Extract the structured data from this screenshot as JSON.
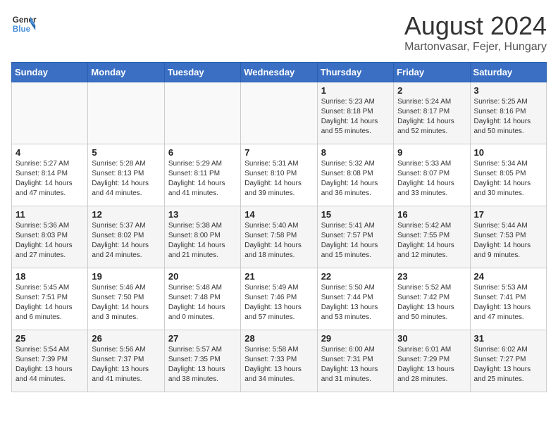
{
  "logo": {
    "line1": "General",
    "line2": "Blue"
  },
  "title": "August 2024",
  "subtitle": "Martonvasar, Fejer, Hungary",
  "days_of_week": [
    "Sunday",
    "Monday",
    "Tuesday",
    "Wednesday",
    "Thursday",
    "Friday",
    "Saturday"
  ],
  "weeks": [
    [
      {
        "day": "",
        "info": ""
      },
      {
        "day": "",
        "info": ""
      },
      {
        "day": "",
        "info": ""
      },
      {
        "day": "",
        "info": ""
      },
      {
        "day": "1",
        "info": "Sunrise: 5:23 AM\nSunset: 8:18 PM\nDaylight: 14 hours\nand 55 minutes."
      },
      {
        "day": "2",
        "info": "Sunrise: 5:24 AM\nSunset: 8:17 PM\nDaylight: 14 hours\nand 52 minutes."
      },
      {
        "day": "3",
        "info": "Sunrise: 5:25 AM\nSunset: 8:16 PM\nDaylight: 14 hours\nand 50 minutes."
      }
    ],
    [
      {
        "day": "4",
        "info": "Sunrise: 5:27 AM\nSunset: 8:14 PM\nDaylight: 14 hours\nand 47 minutes."
      },
      {
        "day": "5",
        "info": "Sunrise: 5:28 AM\nSunset: 8:13 PM\nDaylight: 14 hours\nand 44 minutes."
      },
      {
        "day": "6",
        "info": "Sunrise: 5:29 AM\nSunset: 8:11 PM\nDaylight: 14 hours\nand 41 minutes."
      },
      {
        "day": "7",
        "info": "Sunrise: 5:31 AM\nSunset: 8:10 PM\nDaylight: 14 hours\nand 39 minutes."
      },
      {
        "day": "8",
        "info": "Sunrise: 5:32 AM\nSunset: 8:08 PM\nDaylight: 14 hours\nand 36 minutes."
      },
      {
        "day": "9",
        "info": "Sunrise: 5:33 AM\nSunset: 8:07 PM\nDaylight: 14 hours\nand 33 minutes."
      },
      {
        "day": "10",
        "info": "Sunrise: 5:34 AM\nSunset: 8:05 PM\nDaylight: 14 hours\nand 30 minutes."
      }
    ],
    [
      {
        "day": "11",
        "info": "Sunrise: 5:36 AM\nSunset: 8:03 PM\nDaylight: 14 hours\nand 27 minutes."
      },
      {
        "day": "12",
        "info": "Sunrise: 5:37 AM\nSunset: 8:02 PM\nDaylight: 14 hours\nand 24 minutes."
      },
      {
        "day": "13",
        "info": "Sunrise: 5:38 AM\nSunset: 8:00 PM\nDaylight: 14 hours\nand 21 minutes."
      },
      {
        "day": "14",
        "info": "Sunrise: 5:40 AM\nSunset: 7:58 PM\nDaylight: 14 hours\nand 18 minutes."
      },
      {
        "day": "15",
        "info": "Sunrise: 5:41 AM\nSunset: 7:57 PM\nDaylight: 14 hours\nand 15 minutes."
      },
      {
        "day": "16",
        "info": "Sunrise: 5:42 AM\nSunset: 7:55 PM\nDaylight: 14 hours\nand 12 minutes."
      },
      {
        "day": "17",
        "info": "Sunrise: 5:44 AM\nSunset: 7:53 PM\nDaylight: 14 hours\nand 9 minutes."
      }
    ],
    [
      {
        "day": "18",
        "info": "Sunrise: 5:45 AM\nSunset: 7:51 PM\nDaylight: 14 hours\nand 6 minutes."
      },
      {
        "day": "19",
        "info": "Sunrise: 5:46 AM\nSunset: 7:50 PM\nDaylight: 14 hours\nand 3 minutes."
      },
      {
        "day": "20",
        "info": "Sunrise: 5:48 AM\nSunset: 7:48 PM\nDaylight: 14 hours\nand 0 minutes."
      },
      {
        "day": "21",
        "info": "Sunrise: 5:49 AM\nSunset: 7:46 PM\nDaylight: 13 hours\nand 57 minutes."
      },
      {
        "day": "22",
        "info": "Sunrise: 5:50 AM\nSunset: 7:44 PM\nDaylight: 13 hours\nand 53 minutes."
      },
      {
        "day": "23",
        "info": "Sunrise: 5:52 AM\nSunset: 7:42 PM\nDaylight: 13 hours\nand 50 minutes."
      },
      {
        "day": "24",
        "info": "Sunrise: 5:53 AM\nSunset: 7:41 PM\nDaylight: 13 hours\nand 47 minutes."
      }
    ],
    [
      {
        "day": "25",
        "info": "Sunrise: 5:54 AM\nSunset: 7:39 PM\nDaylight: 13 hours\nand 44 minutes."
      },
      {
        "day": "26",
        "info": "Sunrise: 5:56 AM\nSunset: 7:37 PM\nDaylight: 13 hours\nand 41 minutes."
      },
      {
        "day": "27",
        "info": "Sunrise: 5:57 AM\nSunset: 7:35 PM\nDaylight: 13 hours\nand 38 minutes."
      },
      {
        "day": "28",
        "info": "Sunrise: 5:58 AM\nSunset: 7:33 PM\nDaylight: 13 hours\nand 34 minutes."
      },
      {
        "day": "29",
        "info": "Sunrise: 6:00 AM\nSunset: 7:31 PM\nDaylight: 13 hours\nand 31 minutes."
      },
      {
        "day": "30",
        "info": "Sunrise: 6:01 AM\nSunset: 7:29 PM\nDaylight: 13 hours\nand 28 minutes."
      },
      {
        "day": "31",
        "info": "Sunrise: 6:02 AM\nSunset: 7:27 PM\nDaylight: 13 hours\nand 25 minutes."
      }
    ]
  ]
}
